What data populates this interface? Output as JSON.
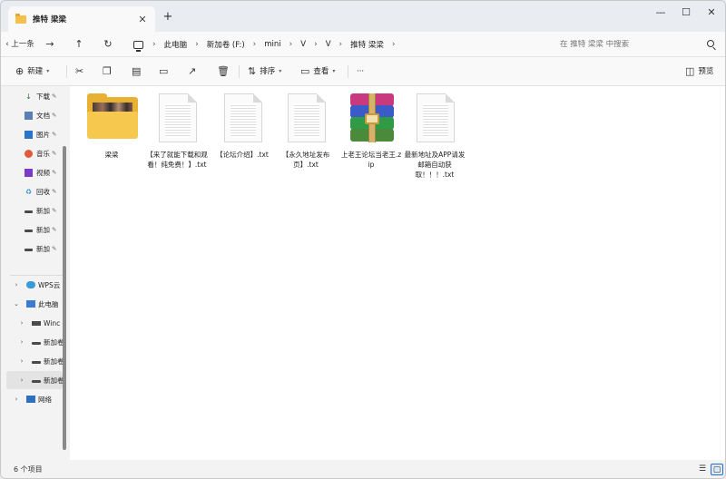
{
  "window": {
    "tab_title": "推特 梁梁",
    "tab_close": "✕",
    "new_tab": "+",
    "minimize": "—",
    "maximize": "☐",
    "close": "✕"
  },
  "nav": {
    "back_label": "上一条",
    "forward": "→",
    "up": "↑",
    "refresh": "↻",
    "breadcrumbs": [
      "此电脑",
      "新加卷 (F:)",
      "mini",
      "V",
      "V",
      "推特 梁梁"
    ],
    "separator": "›",
    "search_placeholder": "在 推特 梁梁 中搜索"
  },
  "commands": {
    "new_label": "新建",
    "sort_label": "排序",
    "view_label": "查看",
    "more": "···",
    "preview_label": "预览"
  },
  "sidebar": {
    "quick_access": [
      {
        "label": "下载",
        "icon": "download-icon"
      },
      {
        "label": "文档",
        "icon": "document-icon"
      },
      {
        "label": "图片",
        "icon": "picture-icon"
      },
      {
        "label": "音乐",
        "icon": "music-icon"
      },
      {
        "label": "视频",
        "icon": "video-icon"
      },
      {
        "label": "回收",
        "icon": "recycle-bin-icon"
      },
      {
        "label": "新加",
        "icon": "drive-icon"
      },
      {
        "label": "新加",
        "icon": "drive-icon"
      },
      {
        "label": "新加",
        "icon": "drive-icon"
      }
    ],
    "tree": [
      {
        "label": "WPS云",
        "icon": "cloud-icon",
        "chevron": "›"
      },
      {
        "label": "此电脑",
        "icon": "computer-icon",
        "chevron": "⌄"
      },
      {
        "label": "Winc",
        "icon": "windows-drive-icon",
        "chevron": "›"
      },
      {
        "label": "新加卷",
        "icon": "drive-icon",
        "chevron": "›"
      },
      {
        "label": "新加卷",
        "icon": "drive-icon",
        "chevron": "›"
      },
      {
        "label": "新加卷",
        "icon": "drive-icon",
        "chevron": "›"
      },
      {
        "label": "网络",
        "icon": "network-icon",
        "chevron": "›"
      }
    ]
  },
  "files": [
    {
      "name": "梁梁",
      "type": "folder"
    },
    {
      "name": "【来了就能下载和观看！纯免费！】.txt",
      "type": "txt"
    },
    {
      "name": "【论坛介绍】.txt",
      "type": "txt"
    },
    {
      "name": "【永久地址发布页】.txt",
      "type": "txt"
    },
    {
      "name": "上老王论坛当老王.zip",
      "type": "zip"
    },
    {
      "name": "最新地址及APP请发邮箱自动获取！！！.txt",
      "type": "txt"
    }
  ],
  "status": {
    "item_count": "6 个项目"
  },
  "colors": {
    "accent": "#2b6cc8",
    "folder": "#f6c84e"
  }
}
